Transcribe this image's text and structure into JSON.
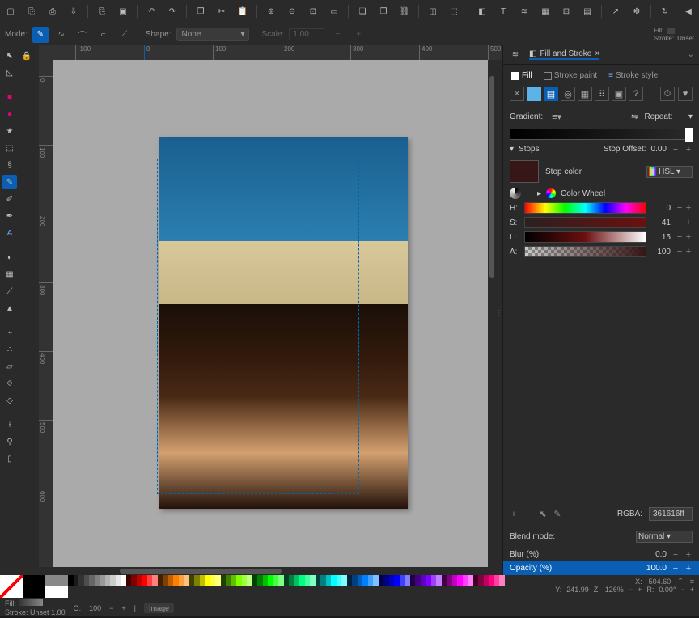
{
  "toolbar_top_icons": [
    "new-file",
    "open-file",
    "print",
    "download",
    "duplicate",
    "copy",
    "sep",
    "undo",
    "redo",
    "sep",
    "copy2",
    "cut",
    "paste",
    "sep",
    "zoom-in",
    "zoom-out",
    "zoom-page",
    "zoom-selection",
    "sep",
    "group",
    "duplicate2",
    "clone",
    "sep",
    "xml",
    "object-properties",
    "sep",
    "fill",
    "text",
    "align",
    "layers",
    "objects",
    "swatches",
    "sep",
    "export",
    "preferences",
    "sep",
    "help",
    "collapse"
  ],
  "mode": {
    "label": "Mode:",
    "shape_label": "Shape:",
    "shape_value": "None",
    "scale_label": "Scale:",
    "scale_value": "1.00"
  },
  "fill_stroke_indicator": {
    "fill_label": "Fill:",
    "stroke_label": "Stroke:",
    "stroke_value": "Unset"
  },
  "tools_left": [
    "selector",
    "node",
    "sep",
    "rect",
    "circle",
    "star",
    "3dbox",
    "spiral",
    "pencil",
    "bezier",
    "calligraphy",
    "text",
    "gradient",
    "mesh",
    "dropper",
    "bucket",
    "tweak",
    "spray",
    "eraser",
    "connector",
    "lpe",
    "measure",
    "zoom",
    "pages"
  ],
  "ruler_marks_h": [
    "-100",
    "0",
    "100",
    "200",
    "300",
    "400",
    "500"
  ],
  "ruler_marks_v": [
    "0",
    "100",
    "200",
    "300",
    "400",
    "500",
    "600"
  ],
  "panel": {
    "title": "Fill and Stroke",
    "subtabs": {
      "fill": "Fill",
      "stroke_paint": "Stroke paint",
      "stroke_style": "Stroke style"
    },
    "gradient_label": "Gradient:",
    "repeat_label": "Repeat:",
    "stops_label": "Stops",
    "stop_offset_label": "Stop Offset:",
    "stop_offset_value": "0.00",
    "stop_color_label": "Stop color",
    "color_mode": "HSL",
    "color_wheel_label": "Color Wheel",
    "hsl": {
      "h_label": "H:",
      "h_val": "0",
      "s_label": "S:",
      "s_val": "41",
      "l_label": "L:",
      "l_val": "15",
      "a_label": "A:",
      "a_val": "100"
    },
    "rgba_label": "RGBA:",
    "rgba_value": "361616ff",
    "blend_label": "Blend mode:",
    "blend_value": "Normal",
    "blur_label": "Blur (%)",
    "blur_value": "0.0",
    "opacity_label": "Opacity (%)",
    "opacity_value": "100.0"
  },
  "status": {
    "fill_label": "Fill:",
    "stroke_label": "Stroke:",
    "stroke_value": "Unset",
    "stroke_width": "1.00",
    "o_label": "O:",
    "o_value": "100",
    "layer": "Image",
    "x_label": "X:",
    "x_value": "504.60",
    "y_label": "Y:",
    "y_value": "241.99",
    "z_label": "Z:",
    "z_value": "126%",
    "r_label": "R:",
    "r_value": "0.00°"
  },
  "palette_colors": [
    "#000",
    "#1a1a1a",
    "#333",
    "#4d4d4d",
    "#666",
    "#808080",
    "#999",
    "#b3b3b3",
    "#ccc",
    "#e6e6e6",
    "#fff",
    "#400000",
    "#800000",
    "#c00000",
    "#f00",
    "#ff4040",
    "#ff8080",
    "#402000",
    "#804000",
    "#c06000",
    "#ff8000",
    "#ffa040",
    "#ffc080",
    "#404000",
    "#808000",
    "#c0c000",
    "#ff0",
    "#ffff40",
    "#ffff80",
    "#204000",
    "#408000",
    "#60c000",
    "#80ff00",
    "#a0ff40",
    "#c0ff80",
    "#004000",
    "#008000",
    "#00c000",
    "#0f0",
    "#40ff40",
    "#80ff80",
    "#004020",
    "#008040",
    "#00c060",
    "#00ff80",
    "#40ffa0",
    "#80ffc0",
    "#004040",
    "#008080",
    "#00c0c0",
    "#0ff",
    "#40ffff",
    "#80ffff",
    "#002040",
    "#004080",
    "#0060c0",
    "#0080ff",
    "#40a0ff",
    "#80c0ff",
    "#000040",
    "#000080",
    "#0000c0",
    "#00f",
    "#4040ff",
    "#8080ff",
    "#200040",
    "#400080",
    "#6000c0",
    "#8000ff",
    "#a040ff",
    "#c080ff",
    "#400040",
    "#800080",
    "#c000c0",
    "#f0f",
    "#ff40ff",
    "#ff80ff",
    "#400020",
    "#800040",
    "#c00060",
    "#ff0080",
    "#ff40a0",
    "#ff80c0"
  ]
}
